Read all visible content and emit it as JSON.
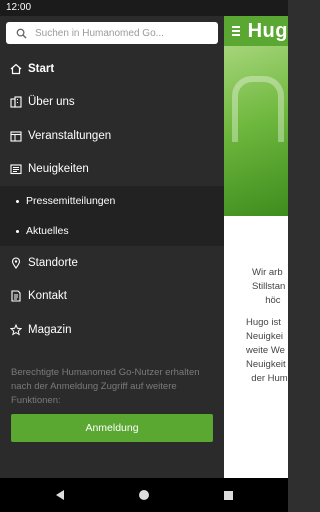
{
  "status": {
    "time": "12:00"
  },
  "drawer": {
    "search_placeholder": "Suchen in Humanomed Go...",
    "items": [
      {
        "label": "Start"
      },
      {
        "label": "Über uns"
      },
      {
        "label": "Veranstaltungen"
      },
      {
        "label": "Neuigkeiten"
      },
      {
        "label": "Standorte"
      },
      {
        "label": "Kontakt"
      },
      {
        "label": "Magazin"
      }
    ],
    "subitems": [
      {
        "label": "Pressemitteilungen"
      },
      {
        "label": "Aktuelles"
      }
    ],
    "info_text": "Berechtigte Humanomed Go-Nutzer erhalten nach der Anmeldung Zugriff auf weitere Funktionen:",
    "login_label": "Anmeldung"
  },
  "background_app": {
    "logo": "Hug",
    "lines": [
      "Wir arb",
      "Stillstan",
      "höc",
      "Hugo ist",
      "Neuigkei",
      "weite We",
      "Neuigkeit",
      "der Hum"
    ]
  },
  "colors": {
    "accent": "#5aa832",
    "drawer_bg": "#2b2b2b",
    "submenu_bg": "#222222"
  }
}
